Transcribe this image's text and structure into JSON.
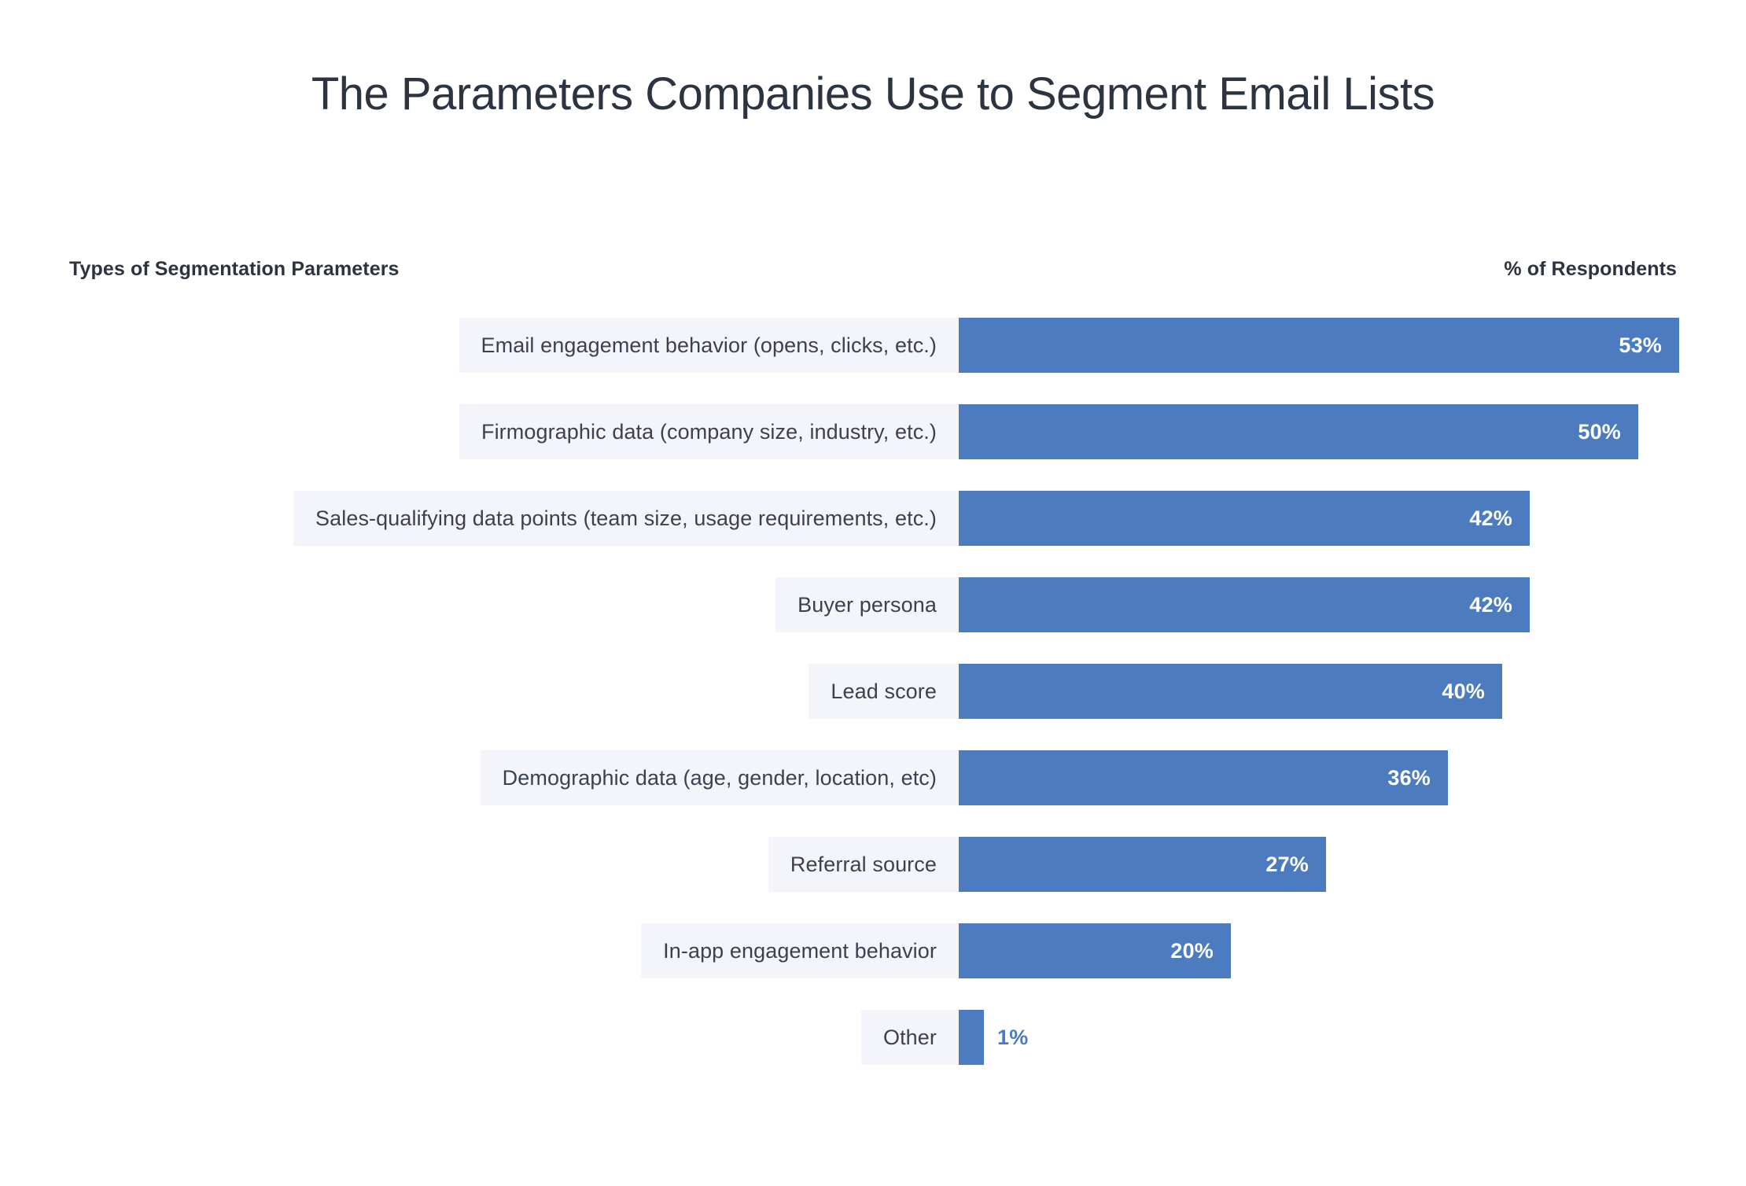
{
  "title": "The Parameters Companies Use to Segment Email Lists",
  "headers": {
    "left": "Types of Segmentation Parameters",
    "right": "% of Respondents"
  },
  "colors": {
    "bar": "#4C7CBF",
    "label_chip": "#F4F5FA",
    "text": "#2B3440",
    "background": "#FFFFFF"
  },
  "chart_data": {
    "type": "bar",
    "orientation": "horizontal",
    "title": "The Parameters Companies Use to Segment Email Lists",
    "xlabel": "% of Respondents",
    "ylabel": "Types of Segmentation Parameters",
    "xlim": [
      0,
      53
    ],
    "grid": false,
    "legend": null,
    "value_suffix": "%",
    "categories": [
      "Email engagement behavior (opens, clicks, etc.)",
      "Firmographic data (company size, industry, etc.)",
      "Sales-qualifying data points (team size, usage requirements, etc.)",
      "Buyer persona",
      "Lead score",
      "Demographic data (age, gender, location, etc)",
      "Referral source",
      "In-app engagement behavior",
      "Other"
    ],
    "values": [
      53,
      50,
      42,
      42,
      40,
      36,
      27,
      20,
      1
    ],
    "labels": [
      "53%",
      "50%",
      "42%",
      "42%",
      "40%",
      "36%",
      "27%",
      "20%",
      "1%"
    ]
  },
  "rows": [
    {
      "label": "Email engagement behavior (opens, clicks, etc.)",
      "value": 53,
      "display": "53%",
      "outside": false
    },
    {
      "label": "Firmographic data (company size, industry, etc.)",
      "value": 50,
      "display": "50%",
      "outside": false
    },
    {
      "label": "Sales-qualifying data points (team size, usage requirements, etc.)",
      "value": 42,
      "display": "42%",
      "outside": false
    },
    {
      "label": "Buyer persona",
      "value": 42,
      "display": "42%",
      "outside": false
    },
    {
      "label": "Lead score",
      "value": 40,
      "display": "40%",
      "outside": false
    },
    {
      "label": "Demographic data (age, gender, location, etc)",
      "value": 36,
      "display": "36%",
      "outside": false
    },
    {
      "label": "Referral source",
      "value": 27,
      "display": "27%",
      "outside": false
    },
    {
      "label": "In-app engagement behavior",
      "value": 20,
      "display": "20%",
      "outside": false
    },
    {
      "label": "Other",
      "value": 1,
      "display": "1%",
      "outside": true
    }
  ]
}
